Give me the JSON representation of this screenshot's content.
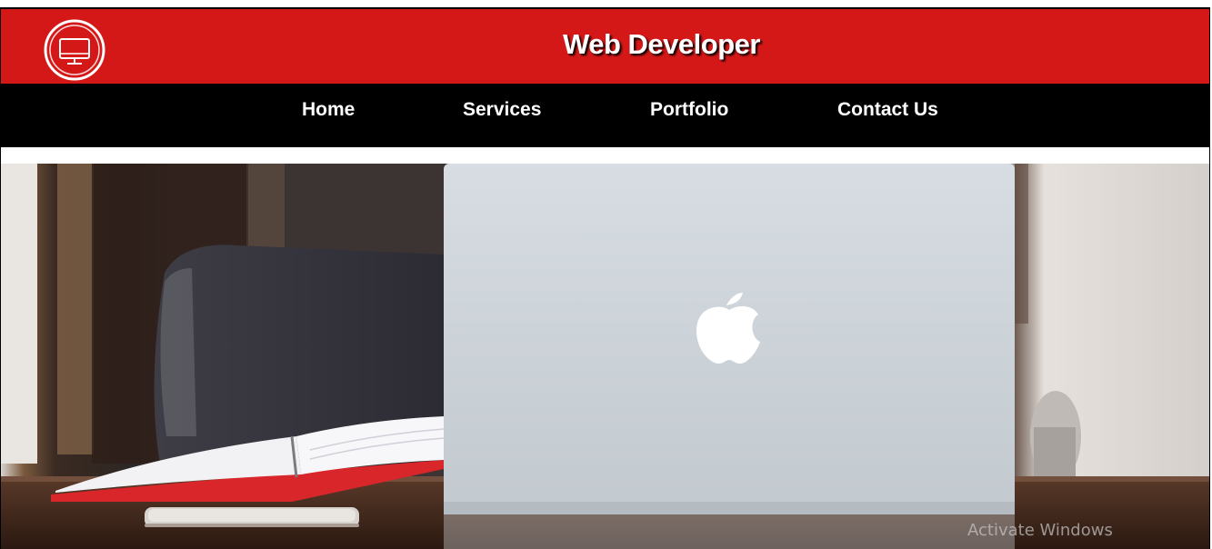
{
  "header": {
    "title": "Web Developer",
    "logo_icon": "monitor-icon",
    "background_color": "#d41818"
  },
  "nav": {
    "background_color": "#000000",
    "items": [
      {
        "label": "Home"
      },
      {
        "label": "Services"
      },
      {
        "label": "Portfolio"
      },
      {
        "label": "Contact Us"
      }
    ]
  },
  "hero": {
    "image_subject": "laptop-on-desk-photo"
  },
  "watermark": {
    "text": "Activate Windows"
  }
}
